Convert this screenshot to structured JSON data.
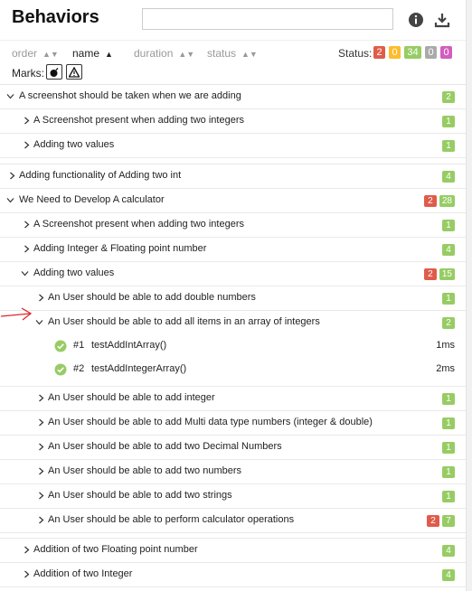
{
  "header": {
    "title": "Behaviors",
    "search_value": "",
    "info_icon": "info-icon",
    "download_icon": "download-icon"
  },
  "sort": {
    "order": "order",
    "name": "name",
    "duration": "duration",
    "status": "status",
    "active": "name"
  },
  "status_filter": {
    "label": "Status:",
    "failed": "2",
    "broken": "0",
    "passed": "34",
    "skipped": "0",
    "unknown": "0"
  },
  "marks": {
    "label": "Marks:",
    "flaky_icon": "bomb-icon",
    "warning_icon": "warning-icon"
  },
  "tree": {
    "g1": {
      "label": "A screenshot should be taken when we are adding",
      "badge": "2"
    },
    "g1a": {
      "label": "A Screenshot present when adding two integers",
      "badge": "1"
    },
    "g1b": {
      "label": "Adding two values",
      "badge": "1"
    },
    "g2": {
      "label": "Adding functionality of Adding two int",
      "badge": "4"
    },
    "g3": {
      "label": "We Need to Develop A calculator",
      "badge_failed": "2",
      "badge_passed": "28"
    },
    "g3a": {
      "label": "A Screenshot present when adding two integers",
      "badge": "1"
    },
    "g3b": {
      "label": "Adding Integer & Floating point number",
      "badge": "4"
    },
    "g3c": {
      "label": "Adding two values",
      "badge_failed": "2",
      "badge_passed": "15"
    },
    "s1": {
      "label": "An User should be able to add double numbers",
      "badge": "1"
    },
    "s2": {
      "label": "An User should be able to add all items in an array of integers",
      "badge": "2"
    },
    "t1": {
      "num": "#1",
      "name": "testAddIntArray()",
      "duration": "1ms"
    },
    "t2": {
      "num": "#2",
      "name": "testAddIntegerArray()",
      "duration": "2ms"
    },
    "s3": {
      "label": "An User should be able to add integer",
      "badge": "1"
    },
    "s4": {
      "label": "An User should be able to add Multi data type numbers (integer & double)",
      "badge": "1"
    },
    "s5": {
      "label": "An User should be able to add two Decimal Numbers",
      "badge": "1"
    },
    "s6": {
      "label": "An User should be able to add two numbers",
      "badge": "1"
    },
    "s7": {
      "label": "An User should be able to add two strings",
      "badge": "1"
    },
    "s8": {
      "label": "An User should be able to perform calculator operations",
      "badge_failed": "2",
      "badge_passed": "7"
    },
    "g3d": {
      "label": "Addition of two Floating point number",
      "badge": "4"
    },
    "g3e": {
      "label": "Addition of two Integer",
      "badge": "4"
    }
  },
  "colors": {
    "failed": "#e05c4a",
    "broken": "#fdbd2c",
    "passed": "#97cc64",
    "skipped": "#aaaaaa",
    "unknown": "#d35ebe",
    "annotation_arrow": "#e0262a"
  }
}
